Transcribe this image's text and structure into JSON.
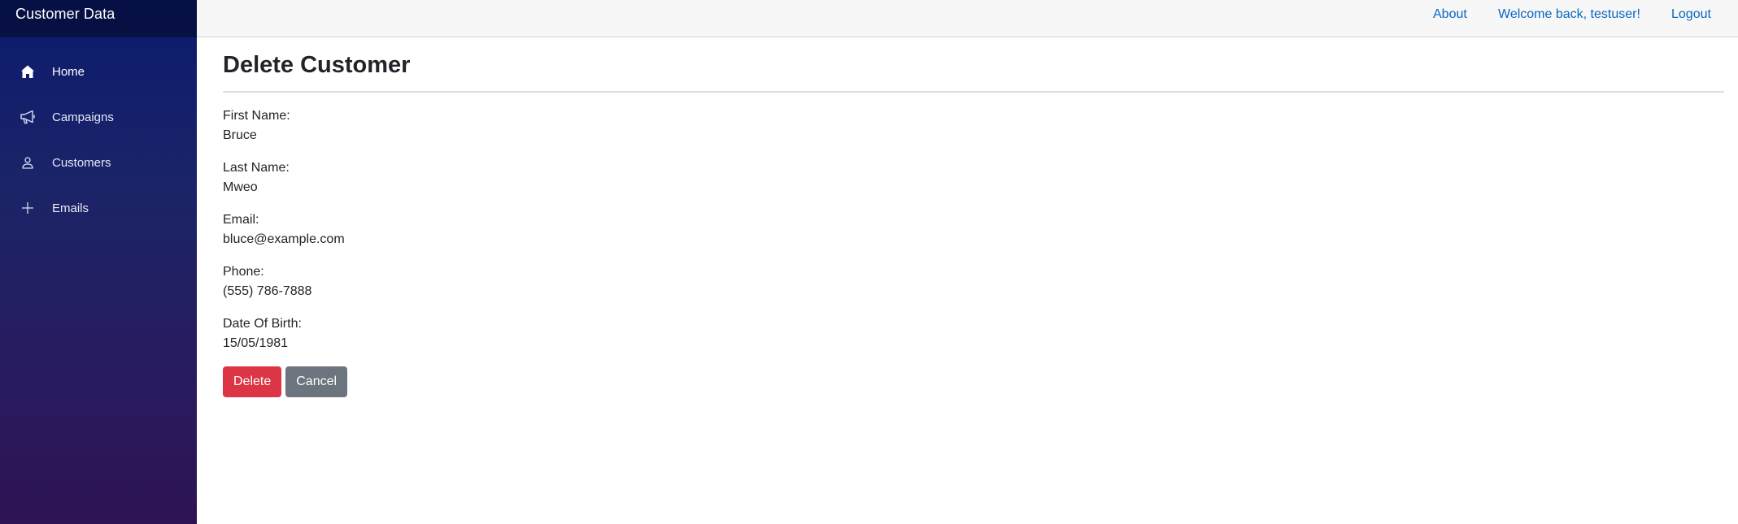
{
  "sidebar": {
    "brand": "Customer Data",
    "items": [
      {
        "label": "Home",
        "icon": "home-icon"
      },
      {
        "label": "Campaigns",
        "icon": "megaphone-icon"
      },
      {
        "label": "Customers",
        "icon": "person-icon"
      },
      {
        "label": "Emails",
        "icon": "plus-icon"
      }
    ]
  },
  "topbar": {
    "about": "About",
    "welcome": "Welcome back, testuser!",
    "logout": "Logout"
  },
  "main": {
    "title": "Delete Customer",
    "fields": [
      {
        "label": "First Name:",
        "value": "Bruce"
      },
      {
        "label": "Last Name:",
        "value": "Mweo"
      },
      {
        "label": "Email:",
        "value": "bluce@example.com"
      },
      {
        "label": "Phone:",
        "value": "(555) 786-7888"
      },
      {
        "label": "Date Of Birth:",
        "value": "15/05/1981"
      }
    ],
    "delete_label": "Delete",
    "cancel_label": "Cancel"
  },
  "colors": {
    "link": "#0a66c2",
    "danger": "#dc3545",
    "secondary": "#6c757d",
    "sidebar_top": "#0a1a6e",
    "sidebar_bottom": "#2d1353"
  }
}
